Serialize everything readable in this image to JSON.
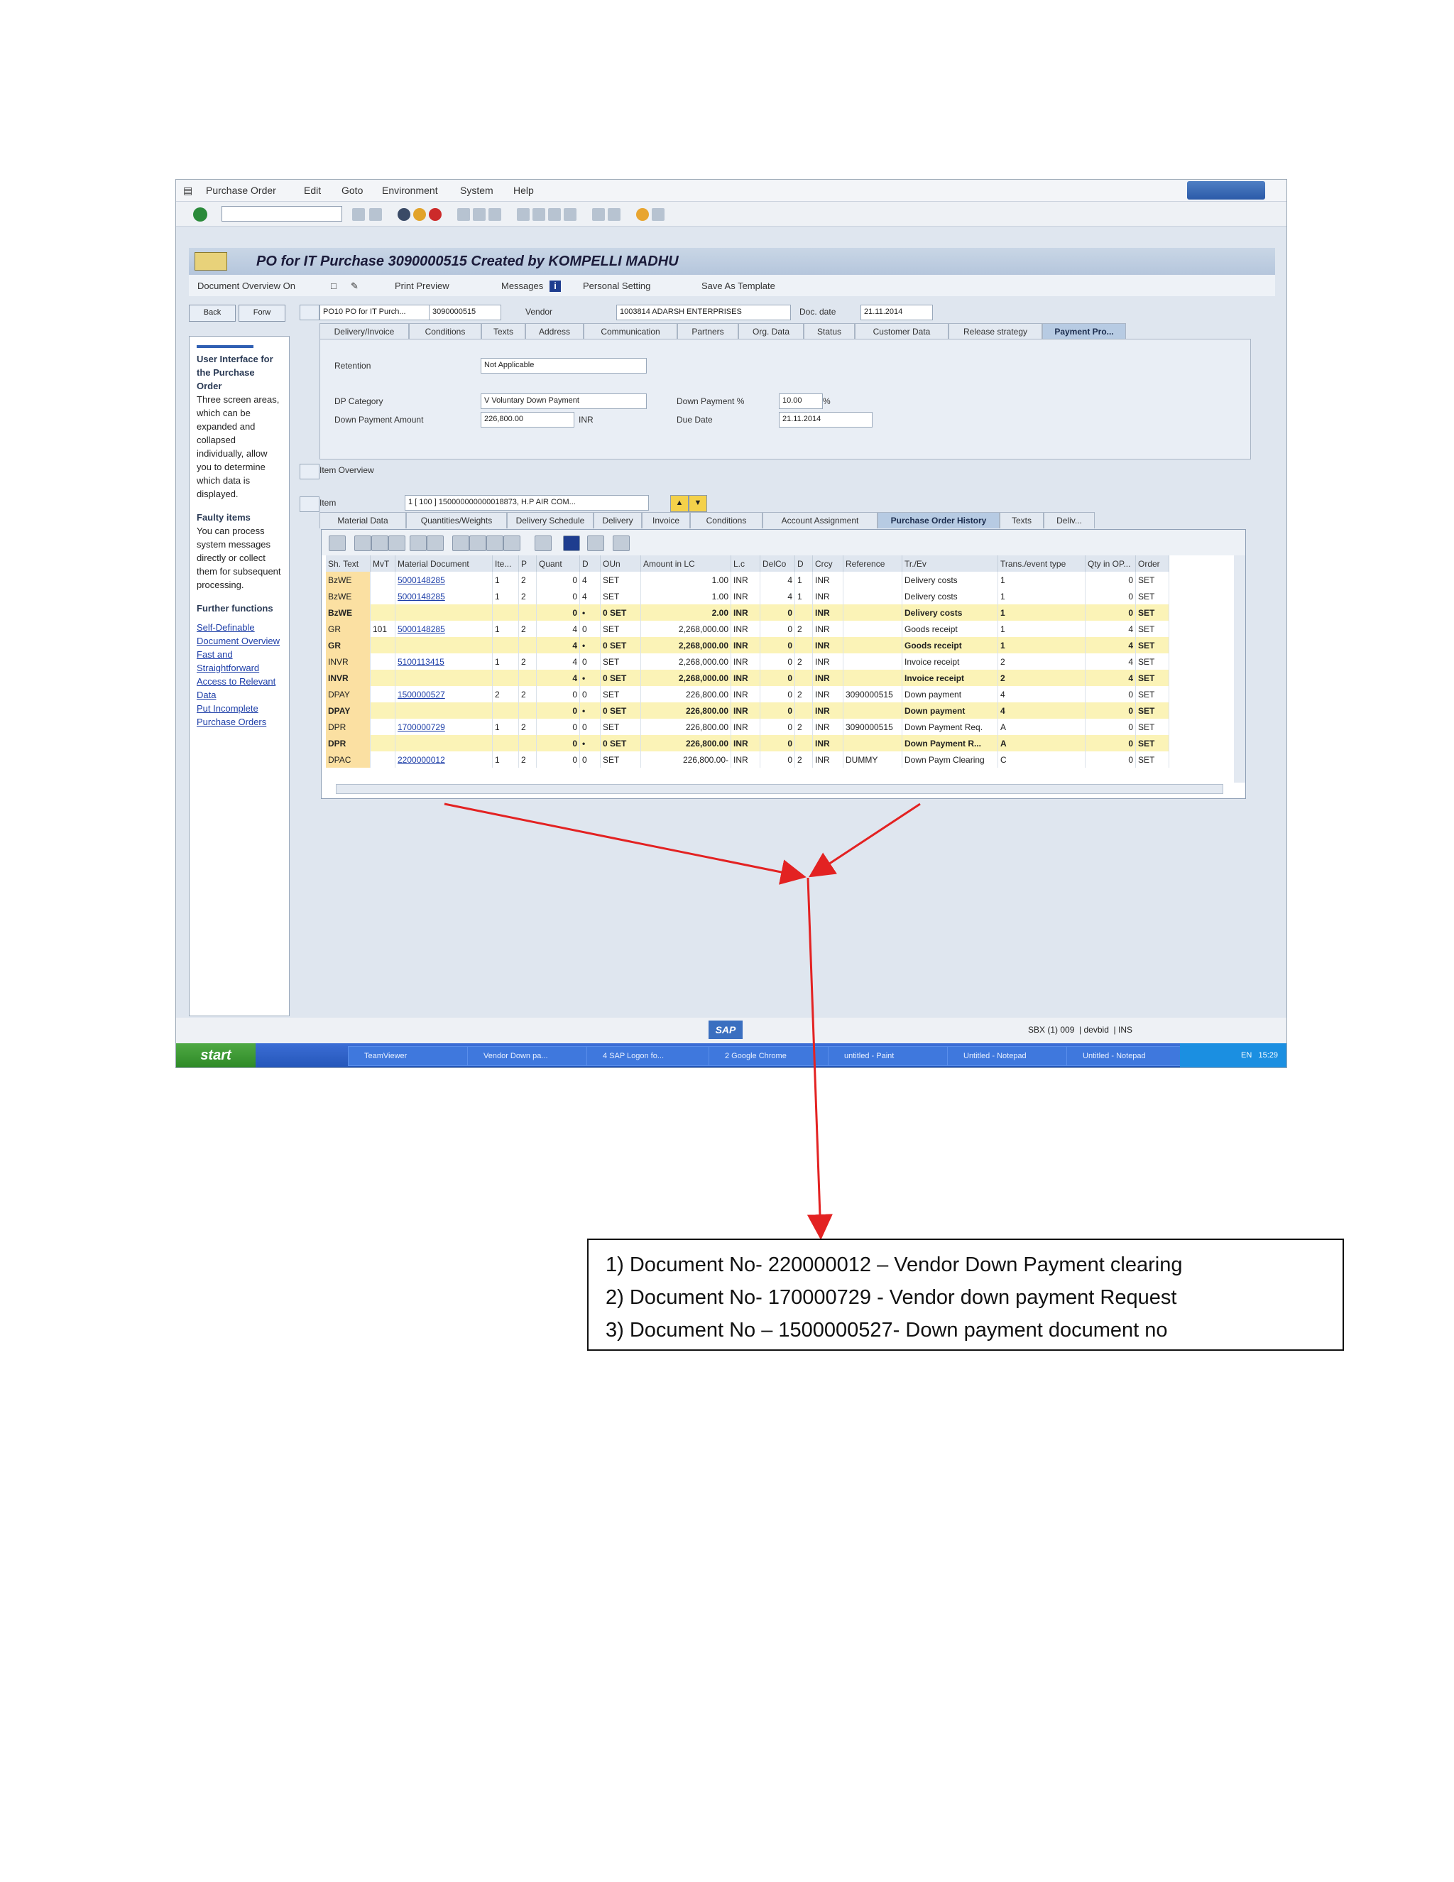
{
  "window": {
    "menu": [
      "Purchase Order",
      "Edit",
      "Goto",
      "Environment",
      "System",
      "Help"
    ],
    "title": "PO for IT Purchase 3090000515 Created by KOMPELLI MADHU",
    "app_toolbar": {
      "document_overview": "Document Overview On",
      "print_preview": "Print Preview",
      "messages": "Messages",
      "personal_setting": "Personal Setting",
      "save_as_template": "Save As Template"
    },
    "nav": {
      "back": "Back",
      "forward": "Forw",
      "po_type": "PO10 PO for IT Purch...",
      "po_number": "3090000515",
      "vendor_label": "Vendor",
      "vendor_value": "1003814 ADARSH ENTERPRISES",
      "doc_date_label": "Doc. date",
      "doc_date_value": "21.11.2014"
    }
  },
  "help_panel": {
    "heading1": "User Interface for the Purchase Order",
    "text1": "Three screen areas, which can be expanded and collapsed individually, allow you to determine which data is displayed.",
    "heading2": "Faulty items",
    "text2": "You can process system messages directly or collect them for subsequent processing.",
    "heading3": "Further functions",
    "links": [
      "Self-Definable Document Overview",
      "Fast and Straightforward Access to Relevant Data",
      "Put Incomplete Purchase Orders"
    ]
  },
  "header_tabs": [
    "Delivery/Invoice",
    "Conditions",
    "Texts",
    "Address",
    "Communication",
    "Partners",
    "Org. Data",
    "Status",
    "Customer Data",
    "Release strategy",
    "Payment Pro..."
  ],
  "header_tabs_active": 10,
  "payment": {
    "retention_label": "Retention",
    "retention_value": "Not Applicable",
    "dp_category_label": "DP Category",
    "dp_category_value": "V Voluntary Down Payment",
    "dp_amount_label": "Down Payment Amount",
    "dp_amount_value": "226,800.00",
    "currency": "INR",
    "dp_percent_label": "Down Payment %",
    "dp_percent_value": "10.00",
    "percent_sign": "%",
    "due_date_label": "Due Date",
    "due_date_value": "21.11.2014"
  },
  "item_overview_label": "Item Overview",
  "item": {
    "label": "Item",
    "value": "1 [ 100 ] 150000000000018873, H.P AIR COM..."
  },
  "item_tabs": [
    "Material Data",
    "Quantities/Weights",
    "Delivery Schedule",
    "Delivery",
    "Invoice",
    "Conditions",
    "Account Assignment",
    "Purchase Order History",
    "Texts",
    "Deliv..."
  ],
  "item_tabs_active": 7,
  "history": {
    "columns": [
      "Sh. Text",
      "MvT",
      "Material Document",
      "Ite...",
      "P",
      "Quant",
      "D",
      "OUn",
      "Amount in LC",
      "L.c",
      "DelCo",
      "D",
      "Crcy",
      "Reference",
      "Tr./Ev",
      "Trans./event type",
      "Qty in OP...",
      "Order"
    ],
    "rows": [
      {
        "type": "norm",
        "c": [
          "BzWE",
          "",
          "5000148285",
          "1",
          "2",
          "0",
          "4",
          "SET",
          "1.00",
          "INR",
          "4",
          "1",
          "INR",
          "",
          "Delivery costs",
          "1",
          "0",
          "SET"
        ]
      },
      {
        "type": "norm",
        "c": [
          "BzWE",
          "",
          "5000148285",
          "1",
          "2",
          "0",
          "4",
          "SET",
          "1.00",
          "INR",
          "4",
          "1",
          "INR",
          "",
          "Delivery costs",
          "1",
          "0",
          "SET"
        ]
      },
      {
        "type": "sum",
        "c": [
          "BzWE",
          "",
          "",
          "",
          "",
          "0",
          "•",
          "0 SET",
          "2.00",
          "INR",
          "0",
          "",
          "INR",
          "",
          "Delivery costs",
          "1",
          "0",
          "SET"
        ]
      },
      {
        "type": "norm",
        "c": [
          "GR",
          "101",
          "5000148285",
          "1",
          "2",
          "4",
          "0",
          "SET",
          "2,268,000.00",
          "INR",
          "0",
          "2",
          "INR",
          "",
          "Goods receipt",
          "1",
          "4",
          "SET"
        ]
      },
      {
        "type": "sum",
        "c": [
          "GR",
          "",
          "",
          "",
          "",
          "4",
          "•",
          "0 SET",
          "2,268,000.00",
          "INR",
          "0",
          "",
          "INR",
          "",
          "Goods receipt",
          "1",
          "4",
          "SET"
        ]
      },
      {
        "type": "norm",
        "c": [
          "INVR",
          "",
          "5100113415",
          "1",
          "2",
          "4",
          "0",
          "SET",
          "2,268,000.00",
          "INR",
          "0",
          "2",
          "INR",
          "",
          "Invoice receipt",
          "2",
          "4",
          "SET"
        ]
      },
      {
        "type": "sum",
        "c": [
          "INVR",
          "",
          "",
          "",
          "",
          "4",
          "•",
          "0 SET",
          "2,268,000.00",
          "INR",
          "0",
          "",
          "INR",
          "",
          "Invoice receipt",
          "2",
          "4",
          "SET"
        ]
      },
      {
        "type": "norm",
        "c": [
          "DPAY",
          "",
          "1500000527",
          "2",
          "2",
          "0",
          "0",
          "SET",
          "226,800.00",
          "INR",
          "0",
          "2",
          "INR",
          "3090000515",
          "Down payment",
          "4",
          "0",
          "SET"
        ]
      },
      {
        "type": "sum",
        "c": [
          "DPAY",
          "",
          "",
          "",
          "",
          "0",
          "•",
          "0 SET",
          "226,800.00",
          "INR",
          "0",
          "",
          "INR",
          "",
          "Down payment",
          "4",
          "0",
          "SET"
        ]
      },
      {
        "type": "norm",
        "c": [
          "DPR",
          "",
          "1700000729",
          "1",
          "2",
          "0",
          "0",
          "SET",
          "226,800.00",
          "INR",
          "0",
          "2",
          "INR",
          "3090000515",
          "Down Payment Req.",
          "A",
          "0",
          "SET"
        ]
      },
      {
        "type": "sum",
        "c": [
          "DPR",
          "",
          "",
          "",
          "",
          "0",
          "•",
          "0 SET",
          "226,800.00",
          "INR",
          "0",
          "",
          "INR",
          "",
          "Down Payment R...",
          "A",
          "0",
          "SET"
        ]
      },
      {
        "type": "norm",
        "c": [
          "DPAC",
          "",
          "2200000012",
          "1",
          "2",
          "0",
          "0",
          "SET",
          "226,800.00-",
          "INR",
          "0",
          "2",
          "INR",
          "DUMMY",
          "Down Paym Clearing",
          "C",
          "0",
          "SET"
        ]
      }
    ]
  },
  "statusbar": {
    "system": "SBX (1) 009",
    "server": "devbid",
    "mode": "INS",
    "logo": "SAP"
  },
  "taskbar": {
    "start": "start",
    "items": [
      "TeamViewer",
      "Vendor Down pa...",
      "4 SAP Logon fo...",
      "2 Google Chrome",
      "untitled - Paint",
      "Untitled - Notepad",
      "Untitled - Notepad"
    ],
    "lang": "EN",
    "time": "15:29"
  },
  "annotation": {
    "lines": [
      "1) Document No- 220000012 – Vendor Down Payment clearing",
      "2) Document No- 170000729 - Vendor down payment Request",
      "3) Document No – 1500000527- Down payment document no"
    ],
    "arrow_color": "#e32222"
  }
}
